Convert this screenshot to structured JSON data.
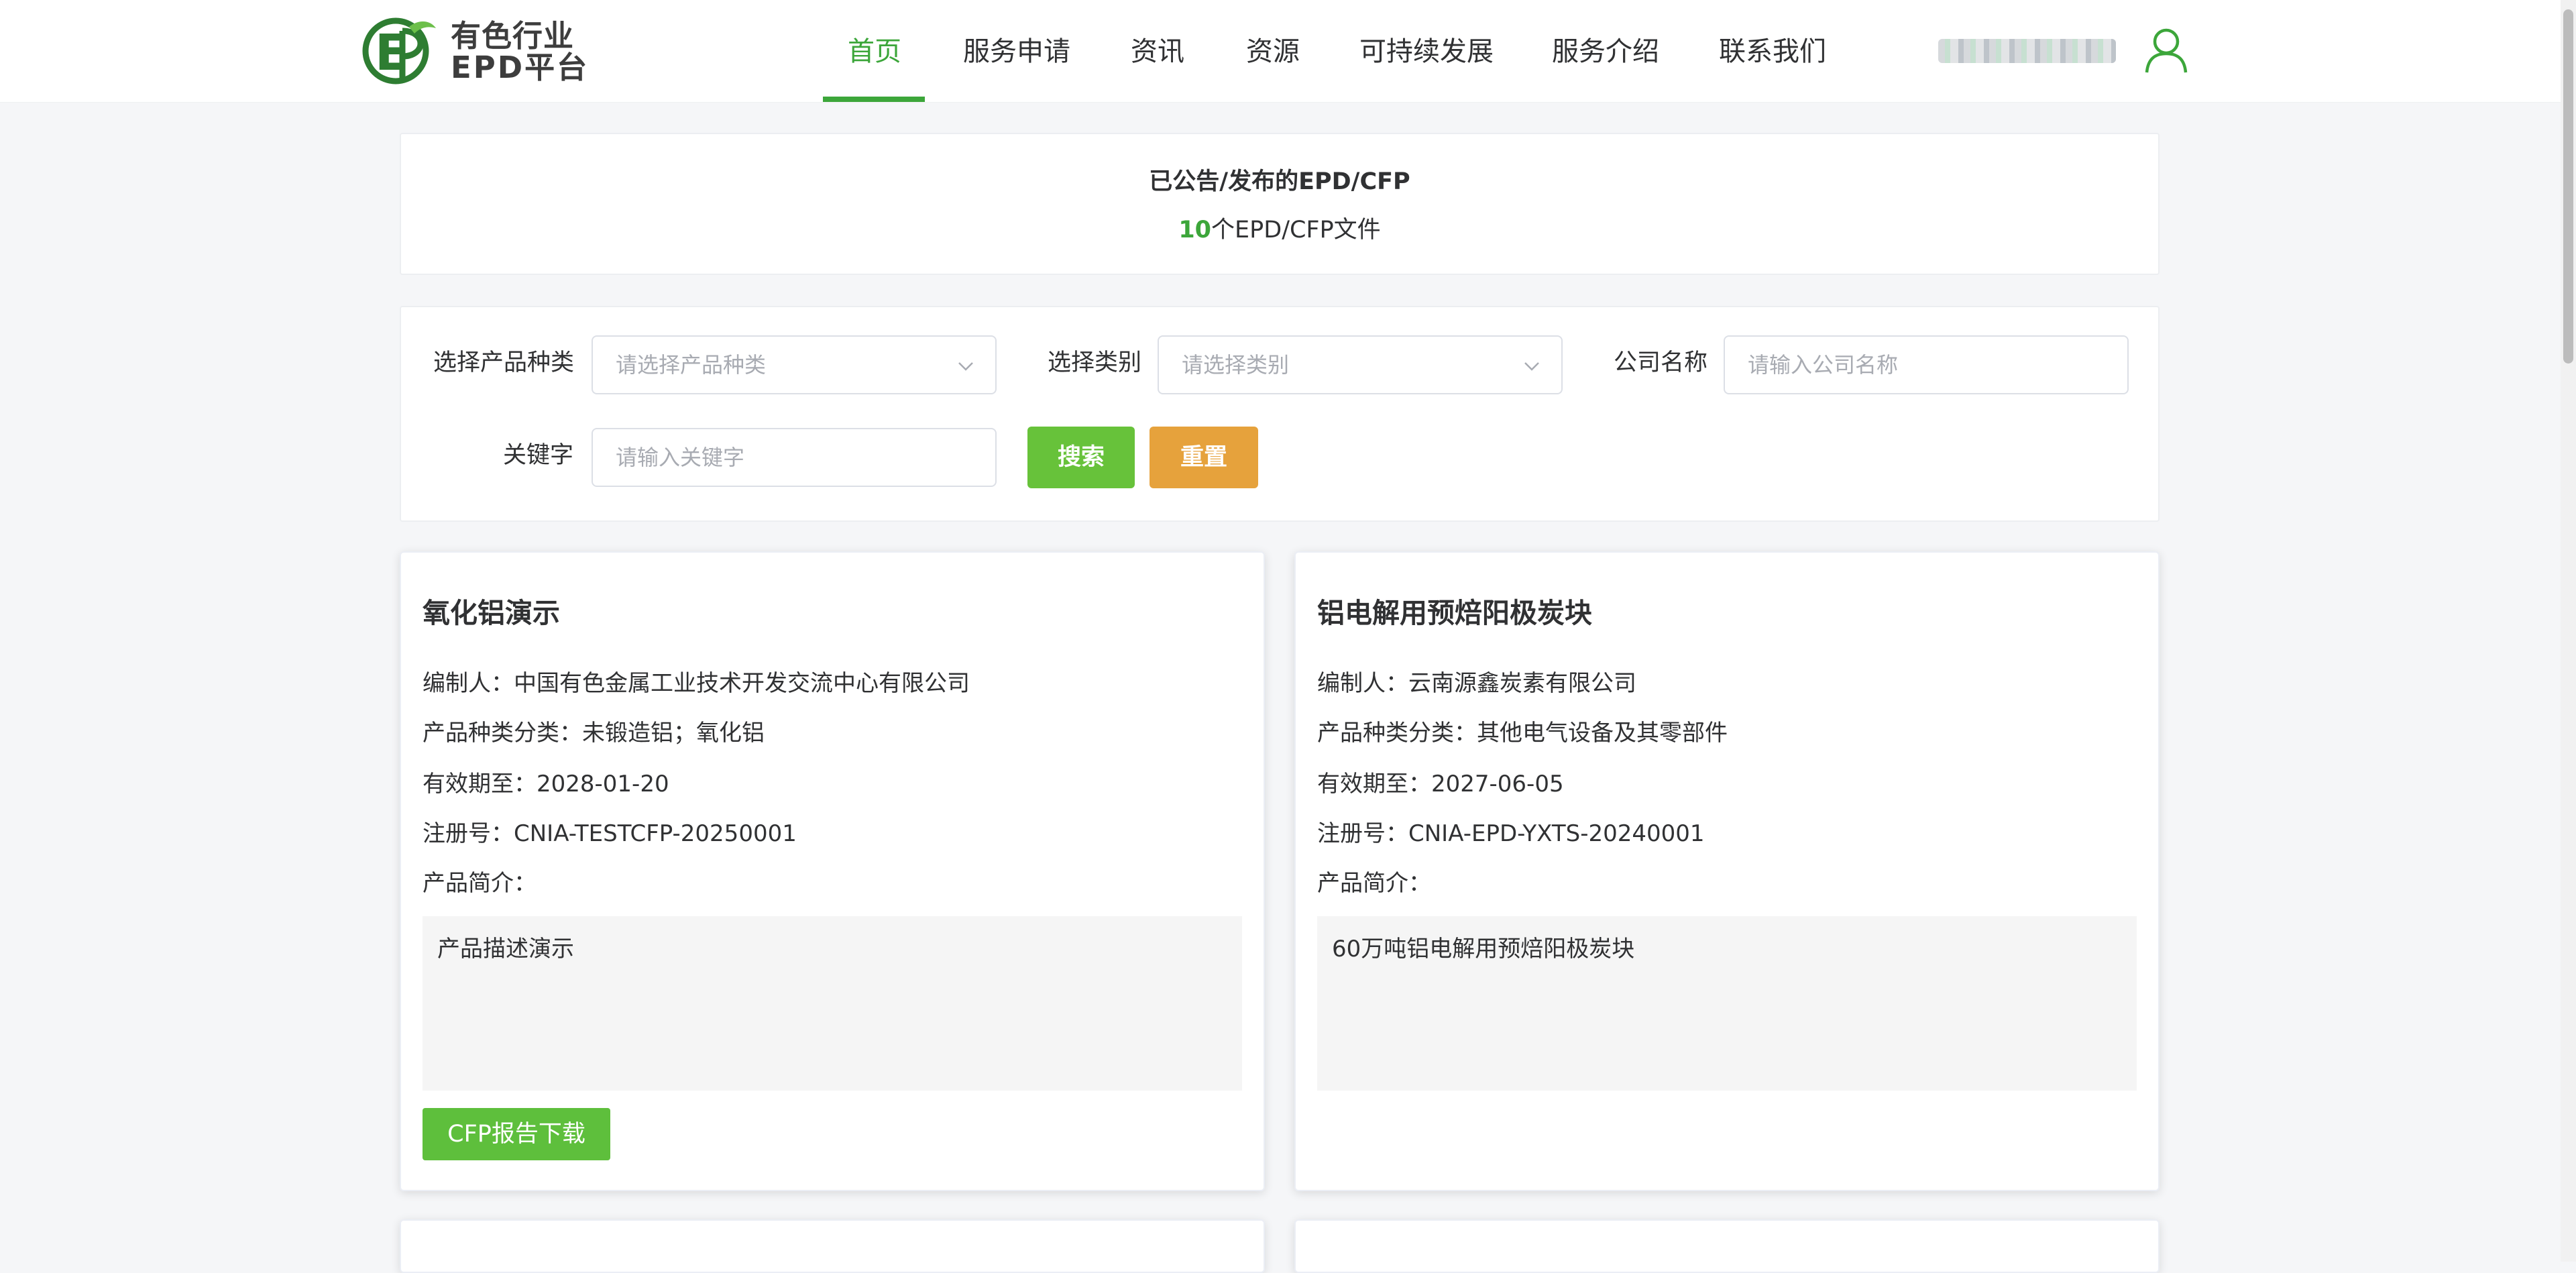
{
  "logo": {
    "line1": "有色行业",
    "line2": "EPD平台"
  },
  "nav": {
    "items": [
      {
        "label": "首页"
      },
      {
        "label": "服务申请"
      },
      {
        "label": "资讯"
      },
      {
        "label": "资源"
      },
      {
        "label": "可持续发展"
      },
      {
        "label": "服务介绍"
      },
      {
        "label": "联系我们"
      }
    ]
  },
  "summary": {
    "title": "已公告/发布的EPD/CFP",
    "count": "10",
    "count_suffix": "个EPD/CFP文件"
  },
  "filters": {
    "product_type_label": "选择产品种类",
    "product_type_placeholder": "请选择产品种类",
    "category_label": "选择类别",
    "category_placeholder": "请选择类别",
    "company_label": "公司名称",
    "company_placeholder": "请输入公司名称",
    "keyword_label": "关键字",
    "keyword_placeholder": "请输入关键字",
    "search_button": "搜索",
    "reset_button": "重置"
  },
  "cards": [
    {
      "title": "氧化铝演示",
      "compiler": "编制人：中国有色金属工业技术开发交流中心有限公司",
      "category": "产品种类分类：未锻造铝；氧化铝",
      "valid_until": "有效期至：2028-01-20",
      "registration": "注册号：CNIA-TESTCFP-20250001",
      "intro_label": "产品简介：",
      "description": "产品描述演示",
      "download_button": "CFP报告下载"
    },
    {
      "title": "铝电解用预焙阳极炭块",
      "compiler": "编制人：云南源鑫炭素有限公司",
      "category": "产品种类分类：其他电气设备及其零部件",
      "valid_until": "有效期至：2027-06-05",
      "registration": "注册号：CNIA-EPD-YXTS-20240001",
      "intro_label": "产品简介：",
      "description": "60万吨铝电解用预焙阳极炭块"
    }
  ],
  "colors": {
    "brand_green": "#3ca63a",
    "search_green": "#67c23a",
    "reset_orange": "#e6a23c"
  }
}
